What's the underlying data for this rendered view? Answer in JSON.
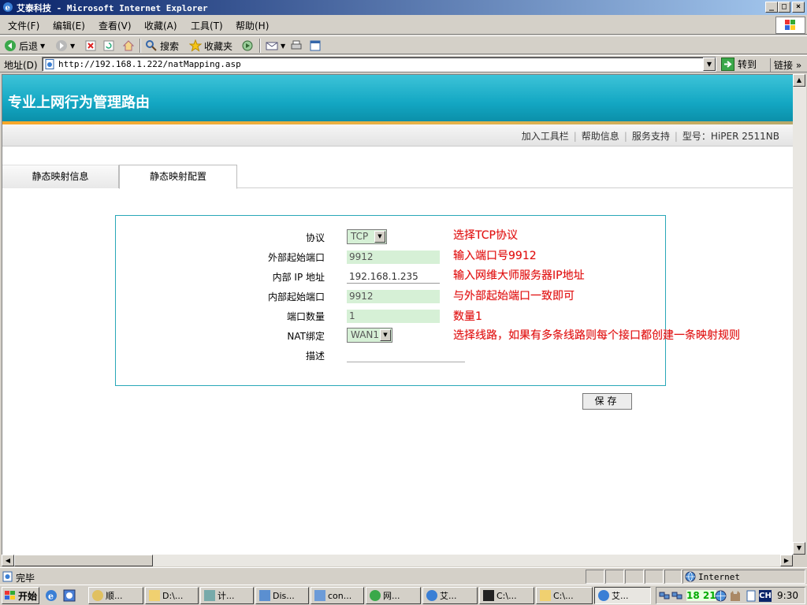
{
  "window": {
    "title": "艾泰科技 - Microsoft Internet Explorer",
    "minimize": "_",
    "maximize": "□",
    "close": "×"
  },
  "menu": [
    "文件(F)",
    "编辑(E)",
    "查看(V)",
    "收藏(A)",
    "工具(T)",
    "帮助(H)"
  ],
  "toolbar": {
    "back": "后退",
    "search": "搜索",
    "favorites": "收藏夹"
  },
  "address": {
    "label": "地址(D)",
    "url": "http://192.168.1.222/natMapping.asp",
    "go": "转到",
    "links": "链接"
  },
  "page": {
    "banner_title": "专业上网行为管理路由",
    "nav_links": [
      "加入工具栏",
      "帮助信息",
      "服务支持",
      "型号：HiPER 2511NB"
    ],
    "tabs": [
      "静态映射信息",
      "静态映射配置"
    ],
    "form": {
      "protocol_label": "协议",
      "protocol_value": "TCP",
      "ext_port_label": "外部起始端口",
      "ext_port_value": "9912",
      "ip_label": "内部 IP 地址",
      "ip_value": "192.168.1.235",
      "int_port_label": "内部起始端口",
      "int_port_value": "9912",
      "count_label": "端口数量",
      "count_value": "1",
      "nat_label": "NAT绑定",
      "nat_value": "WAN1",
      "desc_label": "描述",
      "desc_value": ""
    },
    "notes": {
      "protocol": "选择TCP协议",
      "ext_port": "输入端口号9912",
      "ip": "输入网维大师服务器IP地址",
      "int_port": "与外部起始端口一致即可",
      "count": "数量1",
      "nat": "选择线路，如果有多条线路则每个接口都创建一条映射规则"
    },
    "save": "保存"
  },
  "status": {
    "text": "完毕",
    "zone": "Internet"
  },
  "taskbar": {
    "start": "开始",
    "tasks": [
      "顺...",
      "D:\\...",
      "计...",
      "Dis...",
      "con...",
      "网...",
      "艾...",
      "C:\\...",
      "C:\\...",
      "艾..."
    ],
    "tray_net": "18 21",
    "ime": "CH",
    "clock": "9:30"
  },
  "colors": {
    "banner": "#13a7c3",
    "stripe": "#f7a72a",
    "note": "#e01010",
    "field": "#d6f0d6",
    "panel_border": "#29a8b8"
  }
}
